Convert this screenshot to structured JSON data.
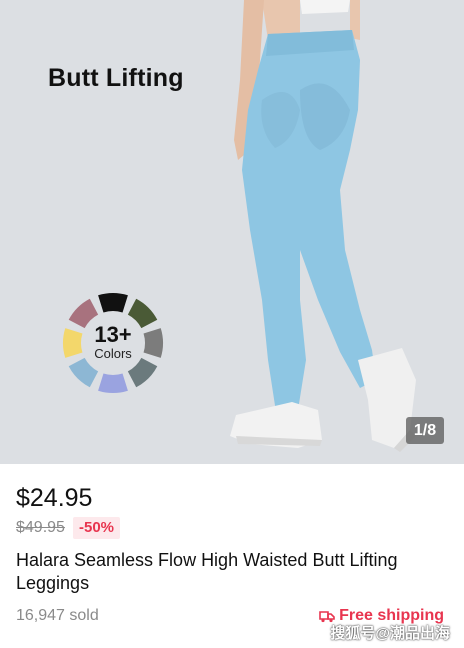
{
  "hero": {
    "title": "Butt Lifting",
    "colors_count": "13+",
    "colors_label": "Colors",
    "page_indicator": "1/8",
    "legging_color": "#8ec6e3",
    "swatches": [
      "#111111",
      "#4a5a36",
      "#7c7c7c",
      "#6b7a7d",
      "#9aa3e0",
      "#8db7d4",
      "#f3d76b",
      "#a8727e"
    ]
  },
  "product": {
    "price": "$24.95",
    "original_price": "$49.95",
    "discount": "-50%",
    "title": "Halara Seamless Flow High Waisted Butt Lifting Leggings",
    "sold": "16,947 sold",
    "shipping": "Free shipping",
    "accent_color": "#e8354f"
  },
  "watermark": "搜狐号@潮品出海"
}
